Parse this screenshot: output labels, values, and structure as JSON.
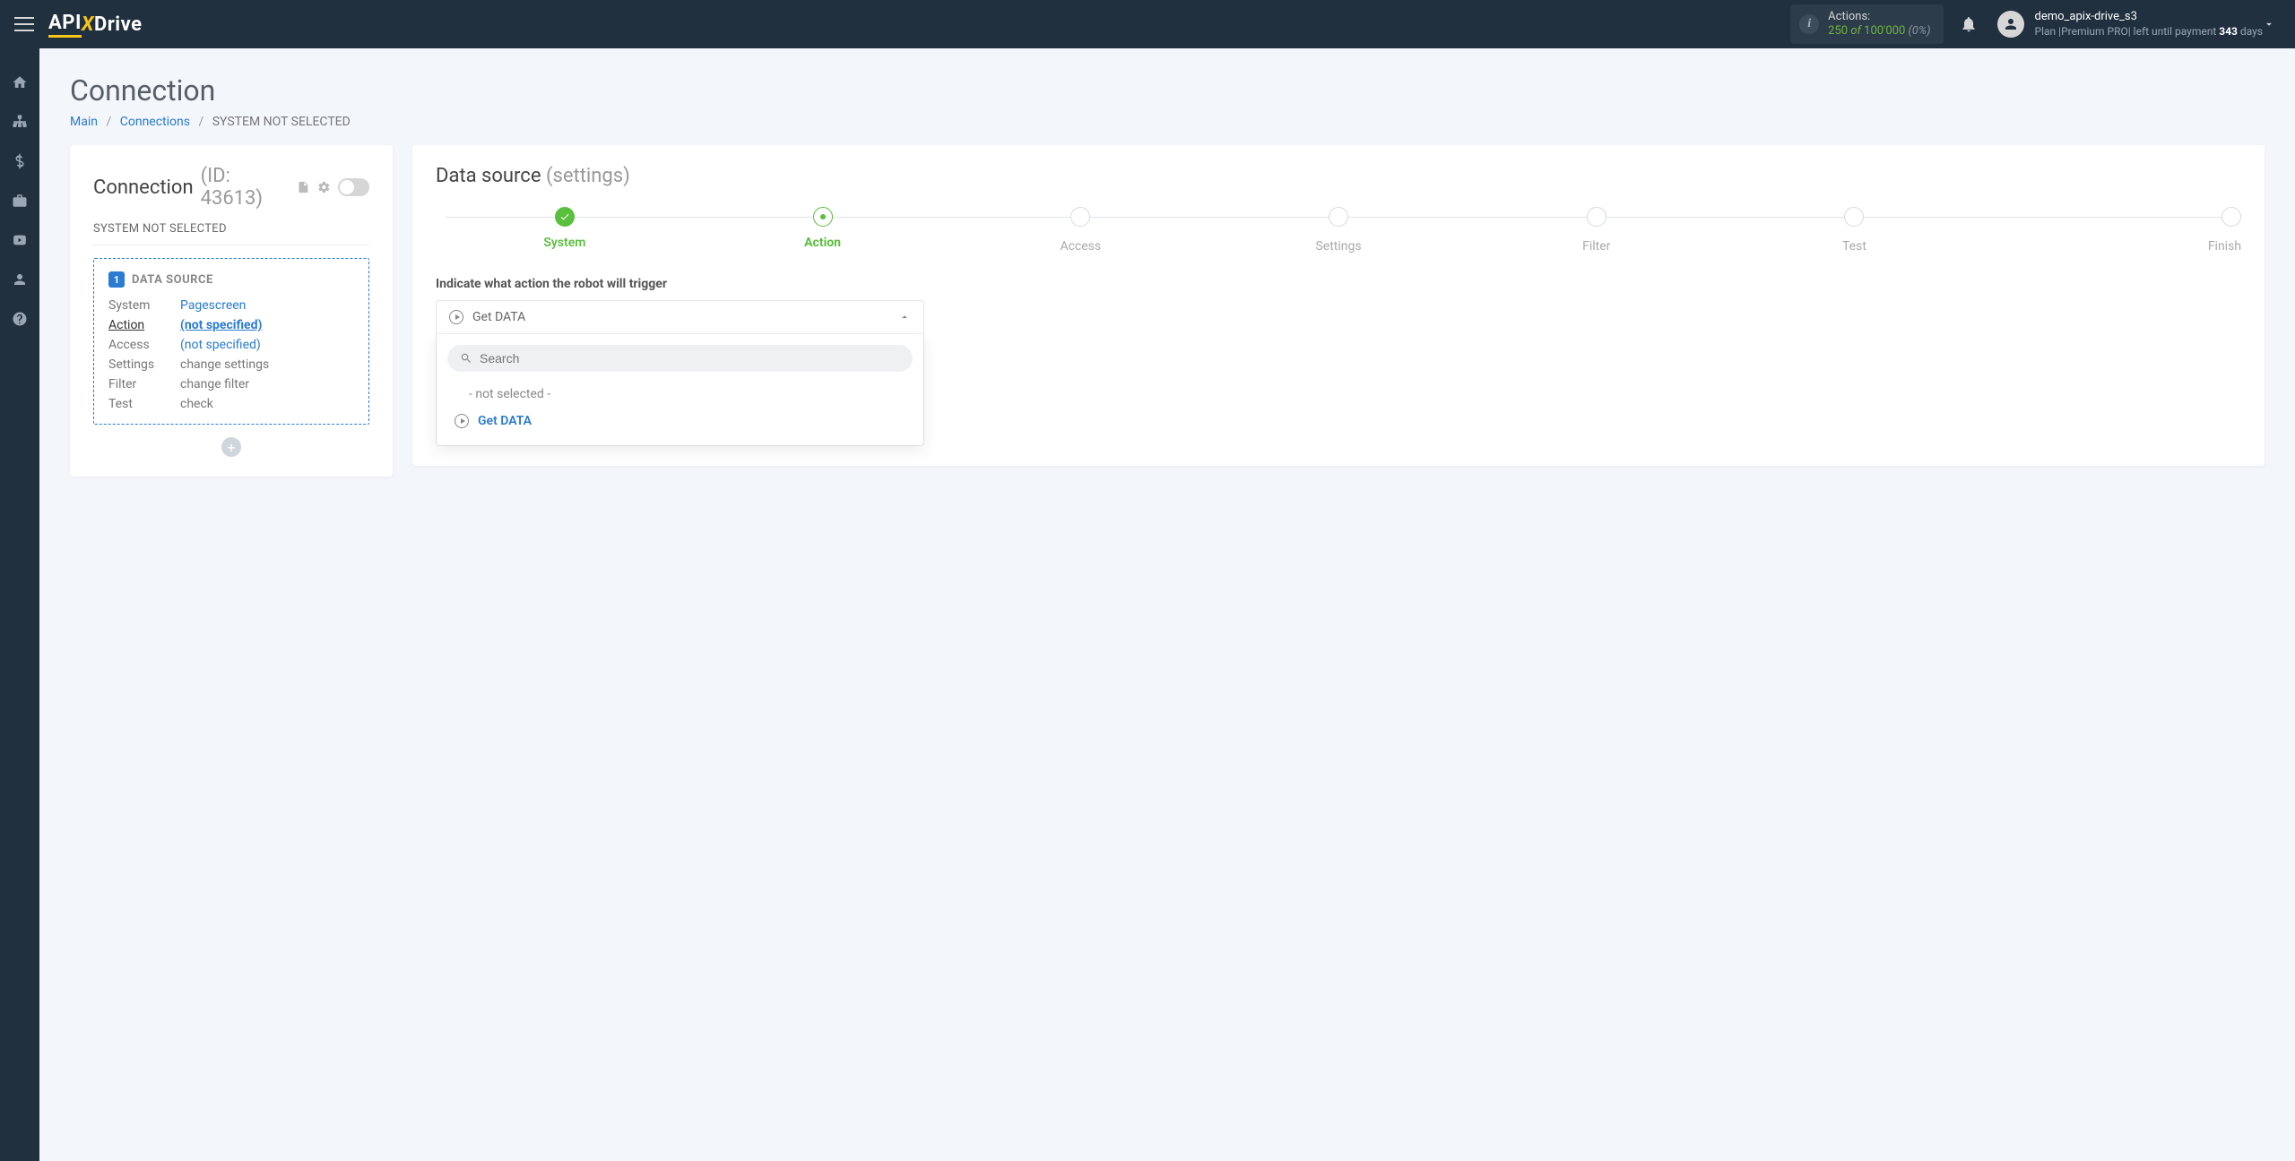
{
  "brand": {
    "api": "API",
    "x": "X",
    "drive": "Drive"
  },
  "actions_pill": {
    "label": "Actions:",
    "used": "250",
    "of": "of",
    "total": "100'000",
    "pct": "(0%)"
  },
  "user": {
    "name": "demo_apix-drive_s3",
    "plan_prefix": "Plan |",
    "plan_name": "Premium PRO",
    "plan_suffix": "| left until payment",
    "days": "343",
    "days_label": "days"
  },
  "page": {
    "title": "Connection",
    "breadcrumb": {
      "main": "Main",
      "connections": "Connections",
      "current": "SYSTEM NOT SELECTED"
    }
  },
  "left": {
    "title": "Connection",
    "id_label": "(ID: 43613)",
    "sys_not": "SYSTEM NOT SELECTED",
    "datasource_label": "DATA SOURCE",
    "badge": "1",
    "rows": {
      "system_k": "System",
      "system_v": "Pagescreen",
      "action_k": "Action",
      "action_v": "(not specified)",
      "access_k": "Access",
      "access_v": "(not specified)",
      "settings_k": "Settings",
      "settings_v": "change settings",
      "filter_k": "Filter",
      "filter_v": "change filter",
      "test_k": "Test",
      "test_v": "check"
    }
  },
  "right": {
    "title": "Data source",
    "subtitle": "(settings)",
    "steps": [
      "System",
      "Action",
      "Access",
      "Settings",
      "Filter",
      "Test",
      "Finish"
    ],
    "section_label": "Indicate what action the robot will trigger",
    "dropdown": {
      "selected": "Get DATA",
      "search_placeholder": "Search",
      "option_none": "- not selected -",
      "option_get": "Get DATA"
    }
  }
}
